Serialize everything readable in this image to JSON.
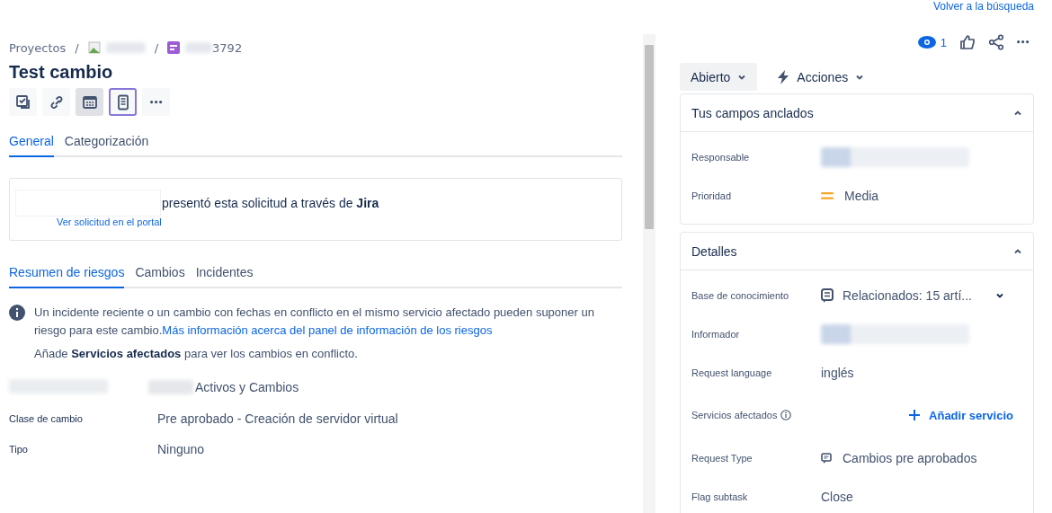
{
  "top_link": "Volver a la búsqueda",
  "breadcrumbs": [
    {
      "kind": "text",
      "text": "Proyectos"
    },
    {
      "kind": "separator",
      "text": "/"
    },
    {
      "kind": "project"
    },
    {
      "kind": "separator",
      "text": "/"
    },
    {
      "kind": "issue",
      "text": "3792"
    }
  ],
  "title": "Test cambio",
  "toolbar": [
    {
      "kind": "checklist",
      "active": false,
      "selected": false
    },
    {
      "kind": "link",
      "active": false,
      "selected": false
    },
    {
      "kind": "calendar",
      "active": true,
      "selected": false
    },
    {
      "kind": "document",
      "active": false,
      "selected": true
    },
    {
      "kind": "more",
      "active": false,
      "selected": false
    }
  ],
  "tabs": [
    {
      "label": "General",
      "selected": true
    },
    {
      "label": "Categorización",
      "selected": false
    }
  ],
  "request_card": {
    "text": "presentó esta solicitud a través de **Jira**",
    "link": "Ver solicitud en el portal"
  },
  "risk_tabs": [
    {
      "label": "Resumen de riesgos",
      "selected": true
    },
    {
      "label": "Cambios",
      "selected": false
    },
    {
      "label": "Incidentes",
      "selected": false
    }
  ],
  "risk_info": {
    "text": "Un incidente reciente o un cambio con fechas en conflicto en el mismo servicio afectado pueden suponer un riesgo para este cambio.",
    "link": "Más información acerca del panel de información de los riesgos",
    "hint": "Añade **Servicios afectados** para ver los cambios en conflicto."
  },
  "fields": [
    {
      "value": "Activos y Cambios"
    },
    {
      "label": "Clase de cambio",
      "value": "Pre aprobado - Creación de servidor virtual"
    },
    {
      "label": "Tipo",
      "value": "Ninguno"
    }
  ],
  "header_actions": {
    "watchers": "1"
  },
  "status": "Abierto",
  "actions": "Acciones",
  "pinned": {
    "title": "Tus campos anclados",
    "expanded": true,
    "rows": [
      {
        "label": "Responsable",
        "kind": "redacted"
      },
      {
        "label": "Prioridad",
        "kind": "priority",
        "value": "Media"
      }
    ]
  },
  "details": {
    "title": "Detalles",
    "expanded": true,
    "rows": [
      {
        "label": "Base de conocimiento",
        "kind": "knowledge",
        "value": "Relacionados: 15 artí..."
      },
      {
        "label": "Informador",
        "kind": "redacted"
      },
      {
        "label": "Request language",
        "kind": "text",
        "value": "inglés"
      },
      {
        "label": "Servicios afectados",
        "kind": "add",
        "value": "Añadir servicio"
      },
      {
        "label": "Request Type",
        "kind": "request",
        "value": "Cambios pre aprobados"
      },
      {
        "label": "Flag subtask",
        "kind": "text",
        "value": "Close"
      }
    ]
  }
}
